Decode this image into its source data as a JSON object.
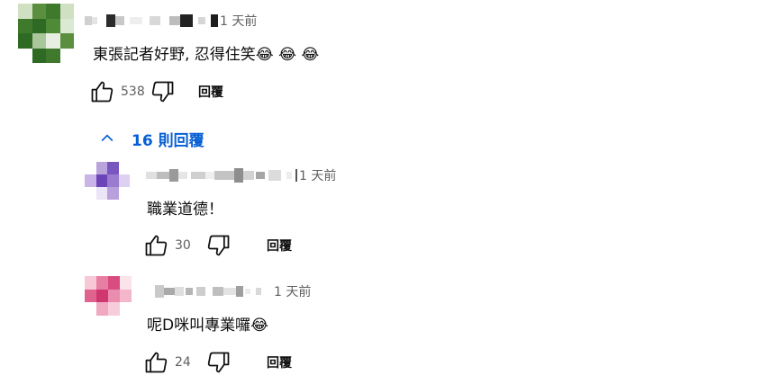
{
  "comment": {
    "time": "1 天前",
    "text": "東張記者好野, 忍得住笑😂 😂 😂",
    "likes": "538",
    "reply_label": "回覆"
  },
  "replies_toggle": {
    "label": "16 則回覆"
  },
  "replies": [
    {
      "time": "1 天前",
      "text": "職業道德！",
      "likes": "30",
      "reply_label": "回覆"
    },
    {
      "time": "1 天前",
      "text": "呢D咪叫專業囉😂",
      "likes": "24",
      "reply_label": "回覆"
    }
  ],
  "colors": {
    "link": "#065fd4",
    "meta": "#606060",
    "text": "#0f0f0f"
  },
  "icons": [
    "thumb-up-icon",
    "thumb-down-icon",
    "chevron-up-icon"
  ]
}
